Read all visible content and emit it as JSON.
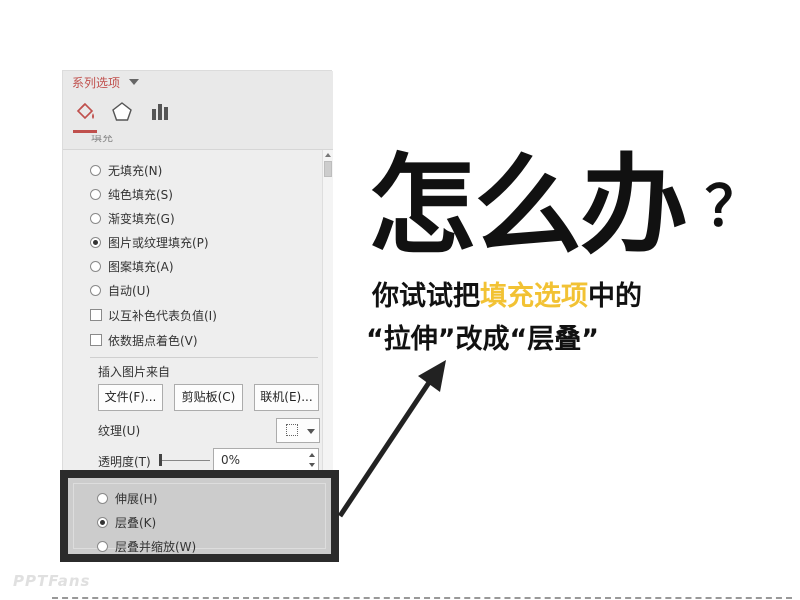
{
  "pane": {
    "series_title": "系列选项",
    "cut_heading": "填充",
    "tabs": [
      {
        "icon": "fill-bucket-icon"
      },
      {
        "icon": "pentagon-icon"
      },
      {
        "icon": "bar-chart-icon"
      }
    ],
    "fill_options": [
      {
        "label": "无填充(N)",
        "checked": false
      },
      {
        "label": "纯色填充(S)",
        "checked": false
      },
      {
        "label": "渐变填充(G)",
        "checked": false
      },
      {
        "label": "图片或纹理填充(P)",
        "checked": true
      },
      {
        "label": "图案填充(A)",
        "checked": false
      },
      {
        "label": "自动(U)",
        "checked": false
      }
    ],
    "checkboxes": [
      {
        "label": "以互补色代表负值(I)",
        "checked": false
      },
      {
        "label": "依数据点着色(V)",
        "checked": false
      }
    ],
    "insert_from_label": "插入图片来自",
    "buttons": {
      "file": "文件(F)...",
      "clipboard": "剪贴板(C)",
      "online": "联机(E)..."
    },
    "texture_label": "纹理(U)",
    "transparency_label": "透明度(T)",
    "transparency_value": "0%",
    "tile_options": [
      {
        "label": "伸展(H)",
        "checked": false
      },
      {
        "label": "层叠(K)",
        "checked": true
      },
      {
        "label": "层叠并缩放(W)",
        "checked": false
      }
    ]
  },
  "callout": {
    "headline": "怎么办",
    "question_mark": "？",
    "line1_pre": "你试试把",
    "line1_accent": "填充选项",
    "line1_post": "中的",
    "line2": "“拉伸”改成“层叠”",
    "accent_color": "#f2c234"
  },
  "watermark": "PPTFans"
}
